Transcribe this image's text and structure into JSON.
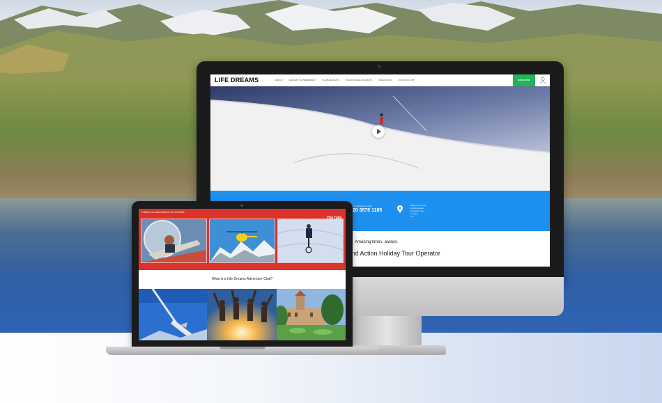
{
  "desktop_site": {
    "logo": "LIFE DREAMS",
    "nav": [
      "ABOUT",
      "HOLIDAY SUPERMARKET",
      "CLUB HOLIDAYS",
      "TAILOR MADE HOLIDAYS",
      "VIDEO BLOG",
      "JOIN OUR LIST"
    ],
    "book_button": "BOOK NOW",
    "contact_label": "Call to talk with us today",
    "phone": "020 3575 1185",
    "address": [
      "Baltimore House,",
      "Hartley Estate,",
      "Lavender Lane,",
      "London,",
      "N4"
    ],
    "tagline": "Amazing times, always.",
    "headline": "ure and Action Holiday Tour Operator",
    "accent_colors": {
      "nav_book": "#23b35a",
      "contact_band": "#1e90f0"
    }
  },
  "laptop_site": {
    "banner_text": "Follow our adventures on YouTube",
    "youtube_logo_you": "You",
    "youtube_logo_tube": "Tube",
    "section_title": "What is a Life Dreams Adventure Club?",
    "accent_colors": {
      "banner": "#d9332c"
    }
  },
  "icons": [
    "play-icon",
    "user-icon",
    "map-pin-icon",
    "youtube-logo"
  ]
}
